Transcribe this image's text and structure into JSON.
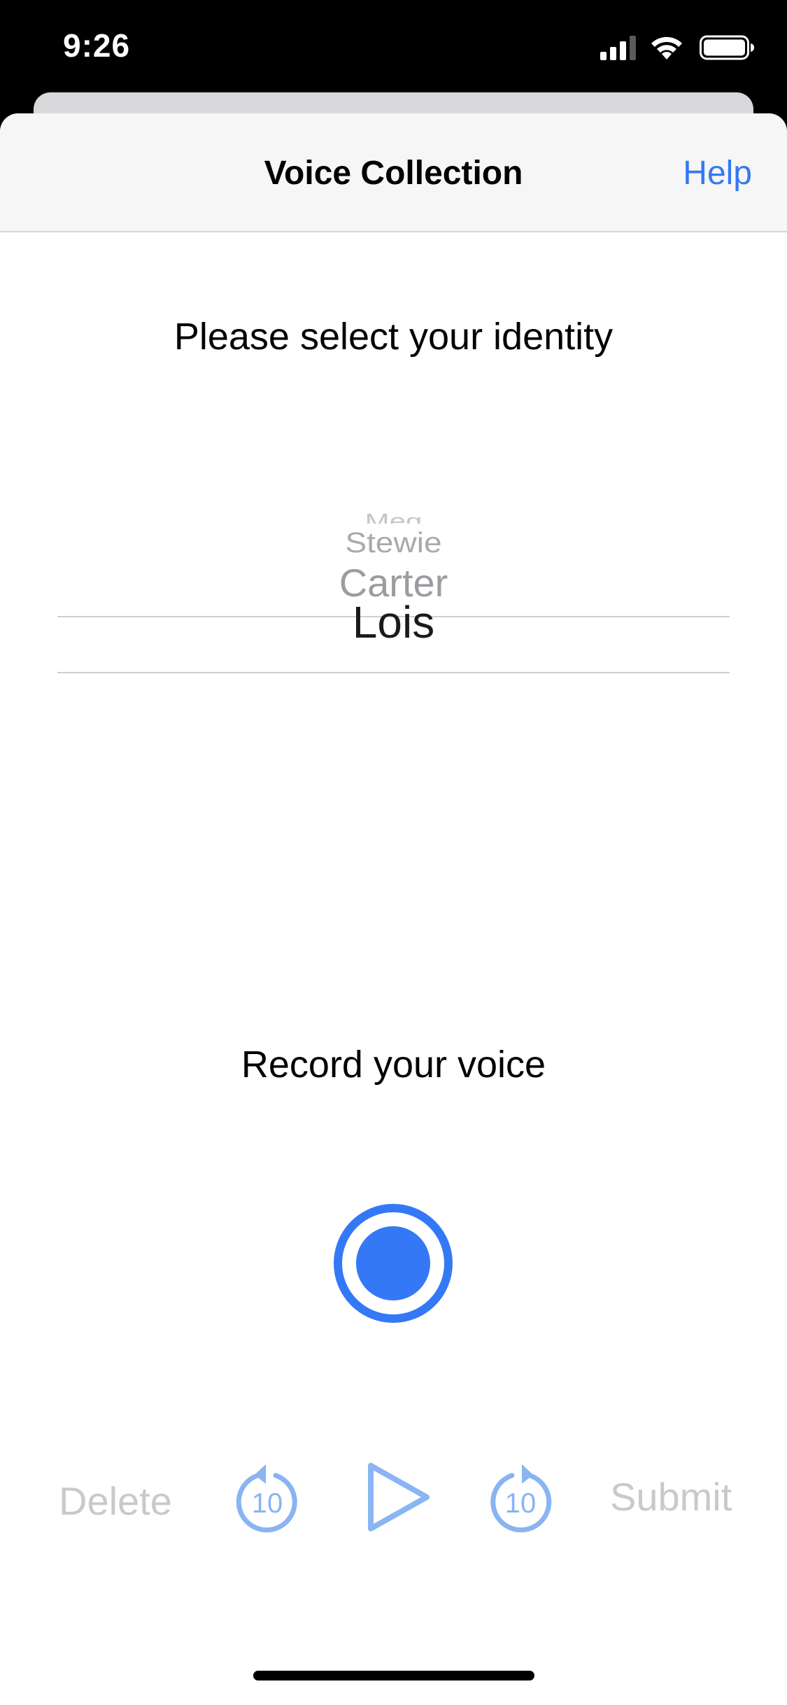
{
  "status_bar": {
    "time": "9:26",
    "icons": [
      "cellular-signal-icon",
      "wifi-icon",
      "battery-icon"
    ]
  },
  "nav": {
    "title": "Voice Collection",
    "help_label": "Help"
  },
  "identity": {
    "prompt": "Please select your identity",
    "options_visible": [
      "Meg",
      "Stewie",
      "Carter",
      "Lois"
    ],
    "selected": "Lois"
  },
  "recording": {
    "prompt": "Record your voice",
    "record_icon": "record-icon"
  },
  "controls": {
    "delete_label": "Delete",
    "rewind_label": "10",
    "rewind_icon": "rewind-10-icon",
    "play_icon": "play-icon",
    "forward_label": "10",
    "forward_icon": "forward-10-icon",
    "submit_label": "Submit"
  },
  "colors": {
    "accent": "#3478f6",
    "accent_disabled": "#8ab4f2",
    "disabled_text": "#c9c9cc",
    "nav_background": "#f6f6f6"
  }
}
